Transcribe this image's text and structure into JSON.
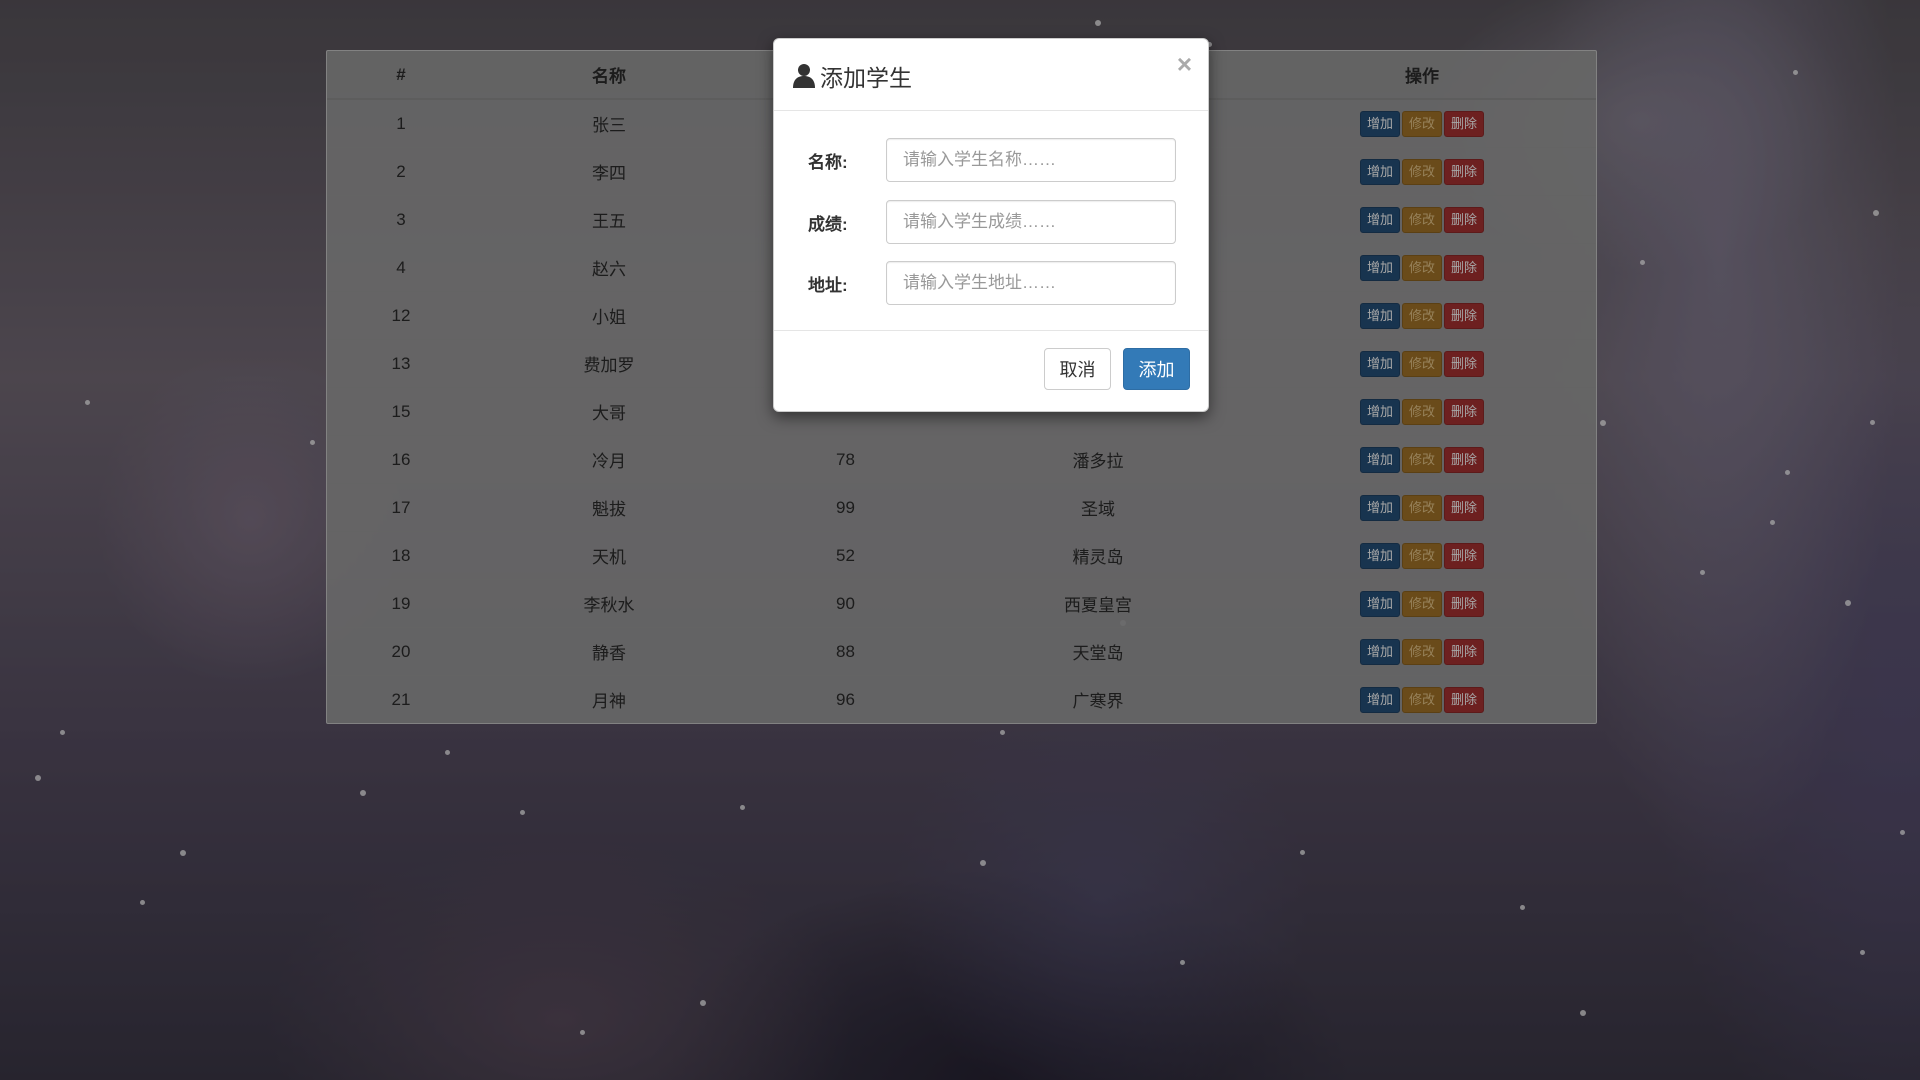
{
  "table": {
    "headers": {
      "id": "#",
      "name": "名称",
      "score": "",
      "address": "",
      "actions": "操作"
    },
    "rows": [
      {
        "id": "1",
        "name": "张三",
        "score": "",
        "address": ""
      },
      {
        "id": "2",
        "name": "李四",
        "score": "",
        "address": ""
      },
      {
        "id": "3",
        "name": "王五",
        "score": "",
        "address": ""
      },
      {
        "id": "4",
        "name": "赵六",
        "score": "",
        "address": ""
      },
      {
        "id": "12",
        "name": "小姐",
        "score": "",
        "address": ""
      },
      {
        "id": "13",
        "name": "费加罗",
        "score": "",
        "address": ""
      },
      {
        "id": "15",
        "name": "大哥",
        "score": "",
        "address": ""
      },
      {
        "id": "16",
        "name": "冷月",
        "score": "78",
        "address": "潘多拉"
      },
      {
        "id": "17",
        "name": "魁拔",
        "score": "99",
        "address": "圣域"
      },
      {
        "id": "18",
        "name": "天机",
        "score": "52",
        "address": "精灵岛"
      },
      {
        "id": "19",
        "name": "李秋水",
        "score": "90",
        "address": "西夏皇宫"
      },
      {
        "id": "20",
        "name": "静香",
        "score": "88",
        "address": "天堂岛"
      },
      {
        "id": "21",
        "name": "月神",
        "score": "96",
        "address": "广寒界"
      }
    ],
    "row_actions": {
      "add": "增加",
      "edit": "修改",
      "delete": "删除"
    }
  },
  "modal": {
    "title": "添加学生",
    "icon": "user-icon",
    "close_symbol": "×",
    "fields": {
      "name_label": "名称:",
      "name_placeholder": "请输入学生名称……",
      "score_label": "成绩:",
      "score_placeholder": "请输入学生成绩……",
      "address_label": "地址:",
      "address_placeholder": "请输入学生地址……"
    },
    "cancel_label": "取消",
    "submit_label": "添加"
  },
  "colors": {
    "primary": "#337ab7",
    "row_add": "#26507a",
    "row_edit": "#a47428",
    "row_delete": "#a83232"
  }
}
